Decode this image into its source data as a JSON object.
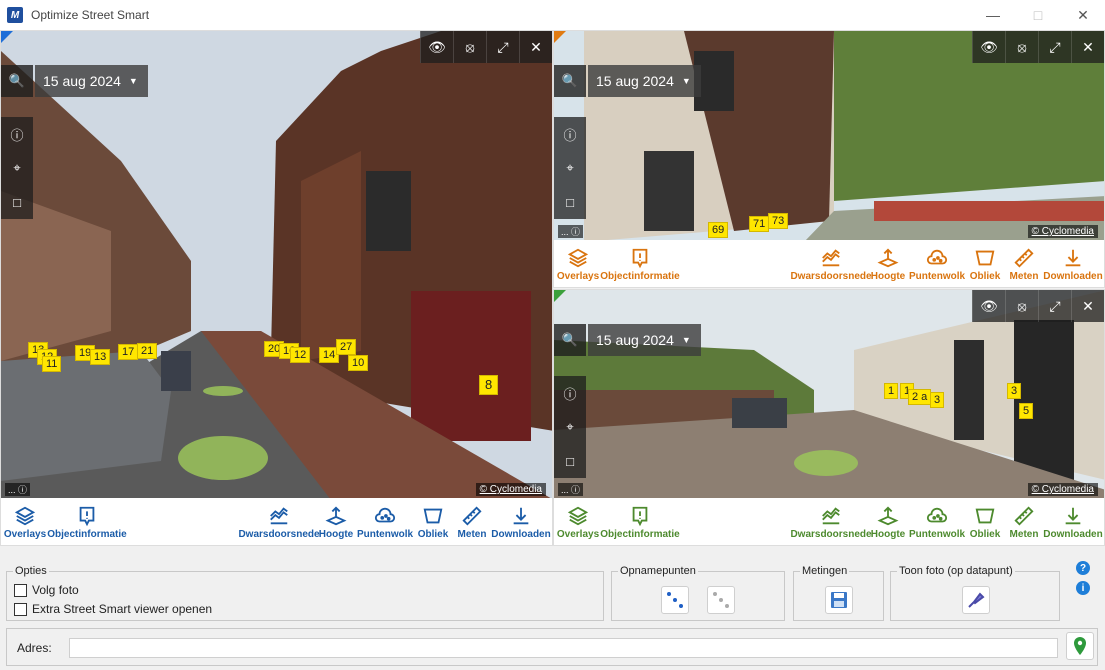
{
  "window": {
    "title": "Optimize Street Smart",
    "logo_letter": "M"
  },
  "viewers": [
    {
      "date": "15 aug 2024",
      "copyright": "© Cyclomedia",
      "markers": [
        "13",
        "12",
        "11",
        "19",
        "13",
        "17",
        "21",
        "20",
        "16",
        "12",
        "14",
        "27",
        "10",
        "8"
      ]
    },
    {
      "date": "15 aug 2024",
      "copyright": "© Cyclomedia",
      "markers": [
        "69",
        "71",
        "73"
      ]
    },
    {
      "date": "15 aug 2024",
      "copyright": "© Cyclomedia",
      "markers": [
        "1",
        "1",
        "2 a",
        "3",
        "3",
        "5"
      ]
    }
  ],
  "toolbar": {
    "overlays": "Overlays",
    "objectinfo": "Objectinformatie",
    "cross": "Dwarsdoorsnede",
    "height": "Hoogte",
    "pointcloud": "Puntenwolk",
    "oblique": "Obliek",
    "measure": "Meten",
    "download": "Downloaden"
  },
  "options": {
    "title": "Opties",
    "follow_photo": "Volg foto",
    "extra_viewer": "Extra Street Smart viewer openen"
  },
  "recording_points": {
    "title": "Opnamepunten"
  },
  "measurements": {
    "title": "Metingen"
  },
  "show_photo": {
    "title": "Toon foto (op datapunt)"
  },
  "address": {
    "label": "Adres:",
    "value": ""
  },
  "colors": {
    "blue": "#1b5ca8",
    "orange": "#d9740f",
    "green": "#4d8a2e"
  }
}
